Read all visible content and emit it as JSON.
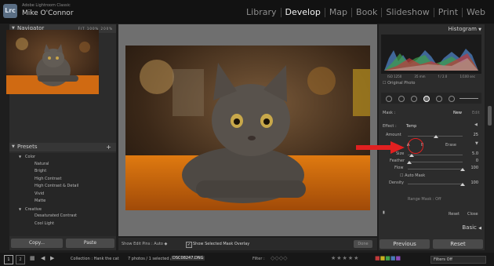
{
  "window": {
    "app_name": "Adobe Lightroom Classic",
    "user": "Mike O'Connor",
    "logo": "Lrc"
  },
  "modules": [
    "Library",
    "Develop",
    "Map",
    "Book",
    "Slideshow",
    "Print",
    "Web"
  ],
  "active_module": "Develop",
  "left_panel": {
    "navigator": {
      "title": "Navigator",
      "zoom": "FIT  100%  200%"
    },
    "presets": {
      "title": "Presets",
      "add": "+",
      "items": [
        {
          "label": "Color",
          "kind": "group"
        },
        {
          "label": "Natural",
          "kind": "item"
        },
        {
          "label": "Bright",
          "kind": "item"
        },
        {
          "label": "High Contrast",
          "kind": "item"
        },
        {
          "label": "High Contrast & Detail",
          "kind": "item"
        },
        {
          "label": "Vivid",
          "kind": "item"
        },
        {
          "label": "Matte",
          "kind": "item"
        },
        {
          "label": "Creative",
          "kind": "group"
        },
        {
          "label": "Desaturated Contrast",
          "kind": "item"
        },
        {
          "label": "Cool Light",
          "kind": "item"
        }
      ]
    },
    "copy_label": "Copy...",
    "paste_label": "Paste"
  },
  "center_toolbar": {
    "show_edit_pins": "Show Edit Pins :",
    "edit_pins_value": "Auto",
    "overlay_label": "Show Selected Mask Overlay",
    "overlay_checked": true,
    "done_label": "Done"
  },
  "right_panel": {
    "histogram_title": "Histogram",
    "info": [
      "ISO 1250",
      "35 mm",
      "f / 2.0",
      "1/100 sec"
    ],
    "original_photo": "Original Photo",
    "mask_label": "Mask :",
    "new_label": "New",
    "edit_label": "Edit",
    "effect_label": "Effect :",
    "effect_value": "Temp",
    "amount_label": "Amount",
    "amount_value": "25",
    "brush_a": "A",
    "brush_b": "B",
    "erase": "Erase",
    "size_label": "Size",
    "size_value": "5.0",
    "feather_label": "Feather",
    "feather_value": "0",
    "flow_label": "Flow",
    "flow_value": "100",
    "automask_label": "Auto Mask",
    "density_label": "Density",
    "density_value": "100",
    "range_mask": "Range Mask : Off",
    "reset_label": "Reset",
    "close_label": "Close",
    "basic_title": "Basic",
    "previous_button": "Previous",
    "reset_button": "Reset"
  },
  "filmstrip": {
    "screen1": "1",
    "screen2": "2",
    "collection": "Collection : Hank the cat",
    "count": "7 photos / 1 selected /",
    "filename": "DSC08247.DNG",
    "filter": "Filter :",
    "filters_off": "Filters Off",
    "stars": "★★★★★"
  },
  "colors": {
    "accent_red": "#e02020",
    "active_text": "#f2f2f2"
  }
}
